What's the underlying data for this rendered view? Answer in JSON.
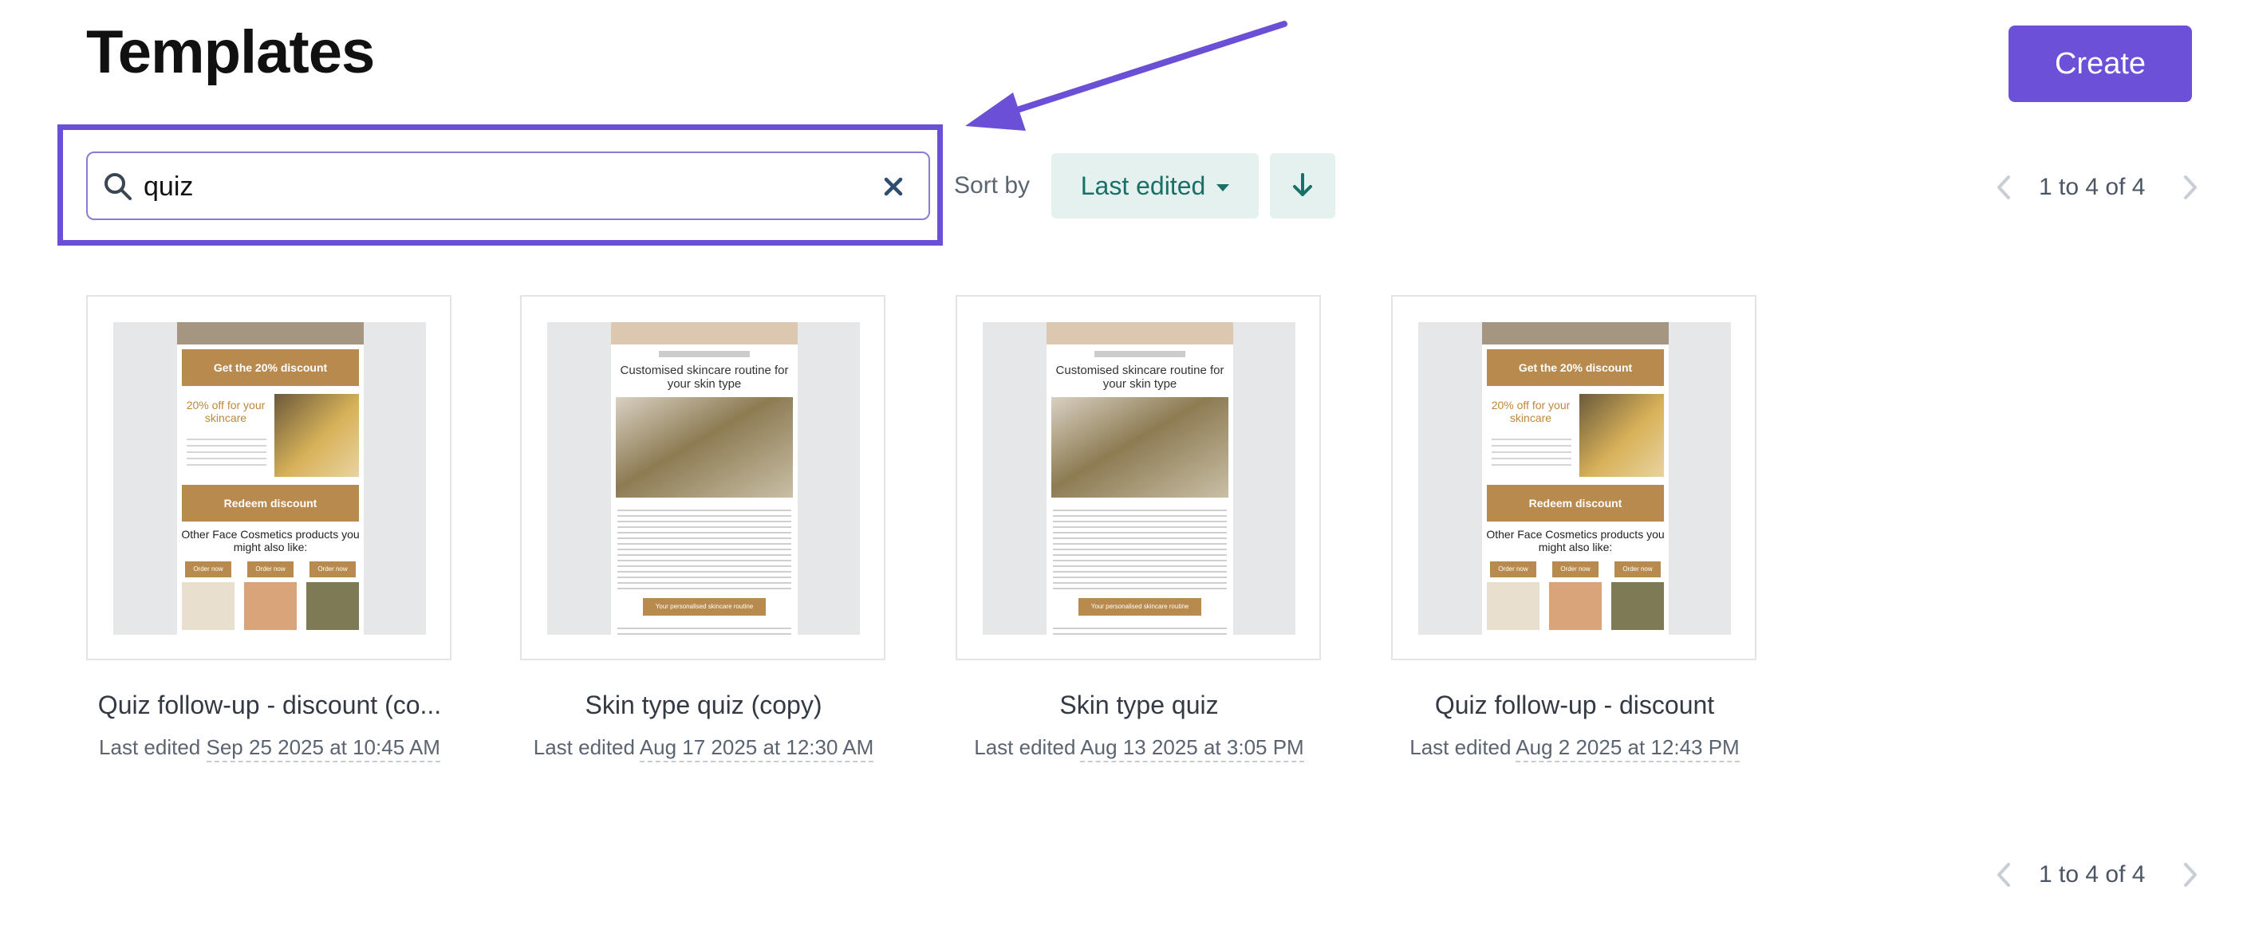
{
  "header": {
    "title": "Templates",
    "create_label": "Create"
  },
  "search": {
    "value": "quiz",
    "placeholder": ""
  },
  "sort": {
    "label": "Sort by",
    "selected": "Last edited",
    "direction": "descending"
  },
  "pagination": {
    "range_text": "1 to 4 of 4"
  },
  "colors": {
    "accent": "#6c50d8",
    "sort_bg": "#e4f1ee",
    "sort_text": "#1a6f68",
    "thumb_tan": "#b98a4e"
  },
  "templates": [
    {
      "title": "Quiz follow-up - discount (co...",
      "edited_prefix": "Last edited",
      "edited_date": "Sep 25 2025 at 10:45 AM",
      "preview": {
        "cta": "Get the 20% discount",
        "offer": "20% off for your skincare",
        "button": "Redeem discount",
        "section": "Other Face Cosmetics products you might also like:",
        "order": "Order now"
      }
    },
    {
      "title": "Skin type quiz (copy)",
      "edited_prefix": "Last edited",
      "edited_date": "Aug 17 2025 at 12:30 AM",
      "preview": {
        "heading": "Customised skincare routine for your skin type",
        "button": "Your personalised skincare routine"
      }
    },
    {
      "title": "Skin type quiz",
      "edited_prefix": "Last edited",
      "edited_date": "Aug 13 2025 at 3:05 PM",
      "preview": {
        "heading": "Customised skincare routine for your skin type",
        "button": "Your personalised skincare routine"
      }
    },
    {
      "title": "Quiz follow-up - discount",
      "edited_prefix": "Last edited",
      "edited_date": "Aug 2 2025 at 12:43 PM",
      "preview": {
        "cta": "Get the 20% discount",
        "offer": "20% off for your skincare",
        "button": "Redeem discount",
        "section": "Other Face Cosmetics products you might also like:",
        "order": "Order now"
      }
    }
  ]
}
